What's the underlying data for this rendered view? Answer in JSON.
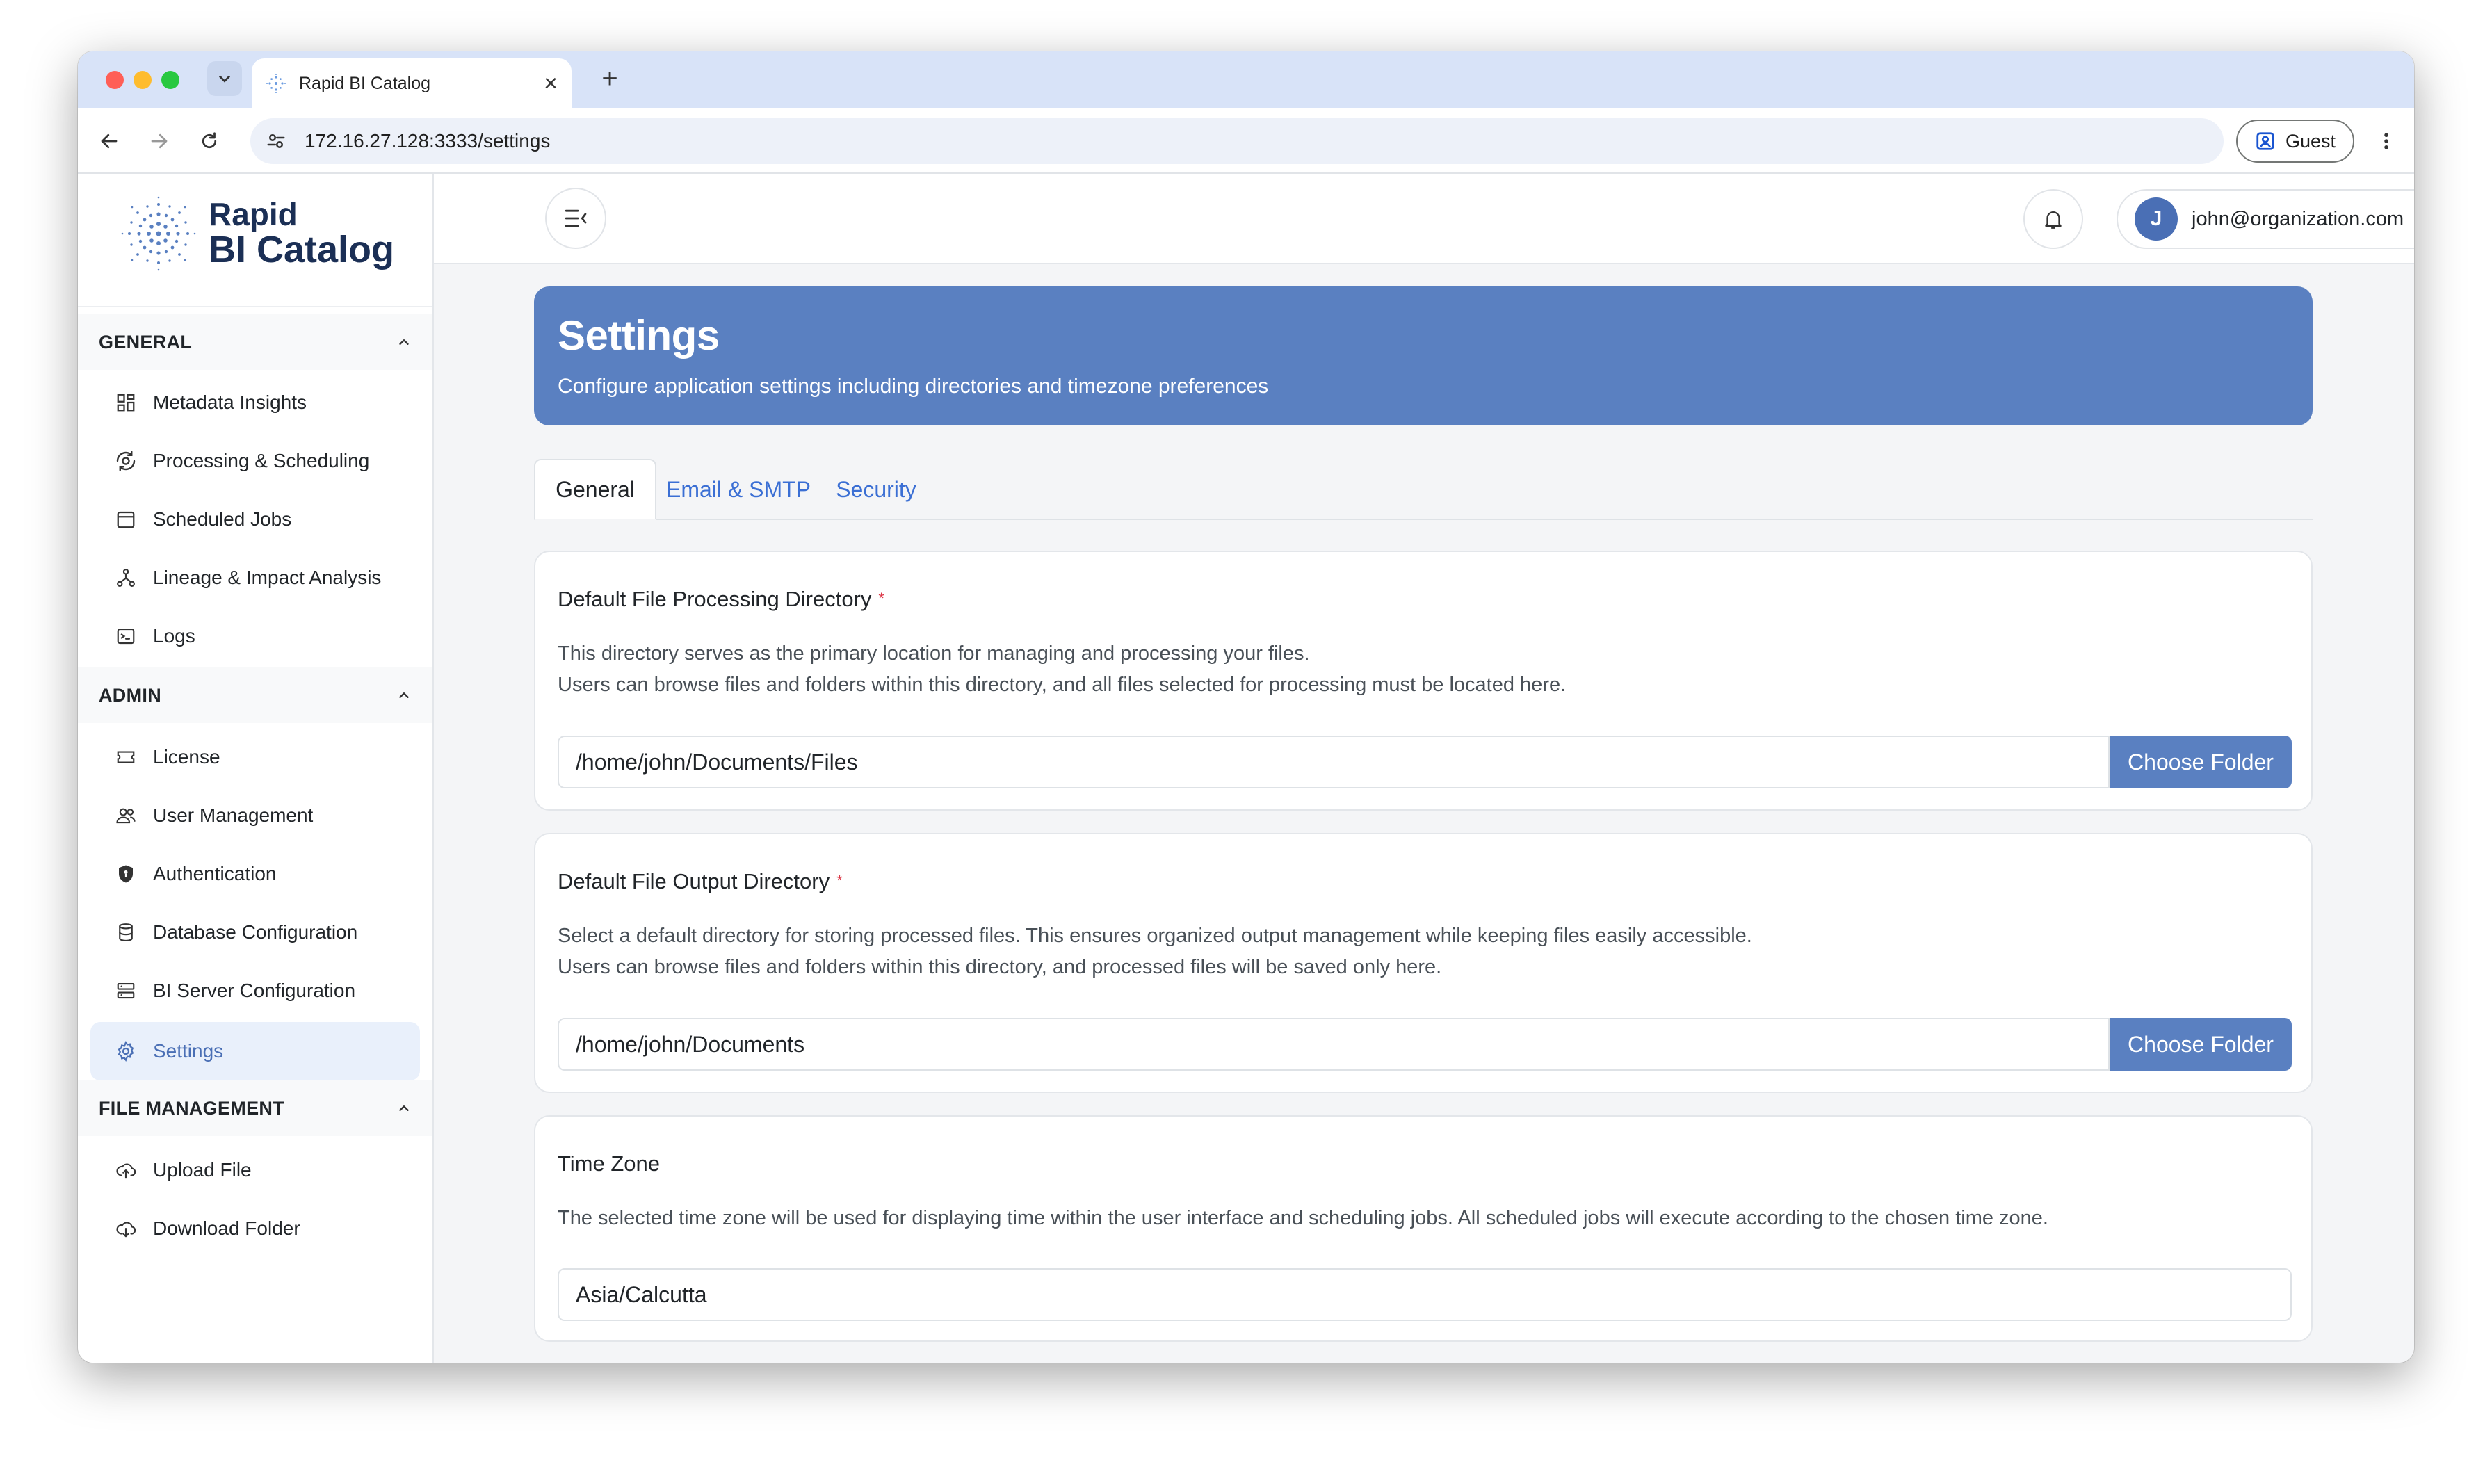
{
  "browser": {
    "tab_title": "Rapid BI Catalog",
    "url": "172.16.27.128:3333/settings",
    "profile_label": "Guest",
    "traffic_lights": [
      "#ff5f57",
      "#febc2e",
      "#28c840"
    ]
  },
  "sidebar": {
    "logo_line1": "Rapid",
    "logo_line2": "BI Catalog",
    "sections": [
      {
        "title": "GENERAL",
        "items": [
          {
            "label": "Metadata Insights",
            "icon": "grid-icon"
          },
          {
            "label": "Processing & Scheduling",
            "icon": "processing-icon"
          },
          {
            "label": "Scheduled Jobs",
            "icon": "calendar-icon"
          },
          {
            "label": "Lineage & Impact Analysis",
            "icon": "lineage-icon"
          },
          {
            "label": "Logs",
            "icon": "terminal-icon"
          }
        ]
      },
      {
        "title": "ADMIN",
        "items": [
          {
            "label": "License",
            "icon": "ticket-icon"
          },
          {
            "label": "User Management",
            "icon": "users-icon"
          },
          {
            "label": "Authentication",
            "icon": "shield-icon"
          },
          {
            "label": "Database Configuration",
            "icon": "database-icon"
          },
          {
            "label": "BI Server Configuration",
            "icon": "server-icon"
          },
          {
            "label": "Settings",
            "icon": "gear-icon",
            "active": true
          }
        ]
      },
      {
        "title": "FILE MANAGEMENT",
        "items": [
          {
            "label": "Upload File",
            "icon": "cloud-upload-icon"
          },
          {
            "label": "Download Folder",
            "icon": "cloud-download-icon"
          }
        ]
      }
    ]
  },
  "topbar": {
    "user_initial": "J",
    "user_email": "john@organization.com"
  },
  "page": {
    "title": "Settings",
    "subtitle": "Configure application settings including directories and timezone preferences",
    "tabs": [
      "General",
      "Email & SMTP",
      "Security"
    ],
    "active_tab": "General"
  },
  "cards": {
    "processing": {
      "label": "Default File Processing Directory",
      "required_mark": "*",
      "desc_line1": "This directory serves as the primary location for managing and processing your files.",
      "desc_line2": "Users can browse files and folders within this directory, and all files selected for processing must be located here.",
      "value": "/home/john/Documents/Files",
      "button": "Choose Folder"
    },
    "output": {
      "label": "Default File Output Directory",
      "required_mark": "*",
      "desc_line1": "Select a default directory for storing processed files. This ensures organized output management while keeping files easily accessible.",
      "desc_line2": "Users can browse files and folders within this directory, and processed files will be saved only here.",
      "value": "/home/john/Documents",
      "button": "Choose Folder"
    },
    "timezone": {
      "label": "Time Zone",
      "desc_line1": "The selected time zone will be used for displaying time within the user interface and scheduling jobs. All scheduled jobs will execute according to the chosen time zone.",
      "value": "Asia/Calcutta"
    }
  },
  "colors": {
    "accent": "#5a80c1",
    "sidebar_active_bg": "#e9f0fb",
    "required": "#dc3545",
    "tab_link": "#3b6fd4"
  }
}
